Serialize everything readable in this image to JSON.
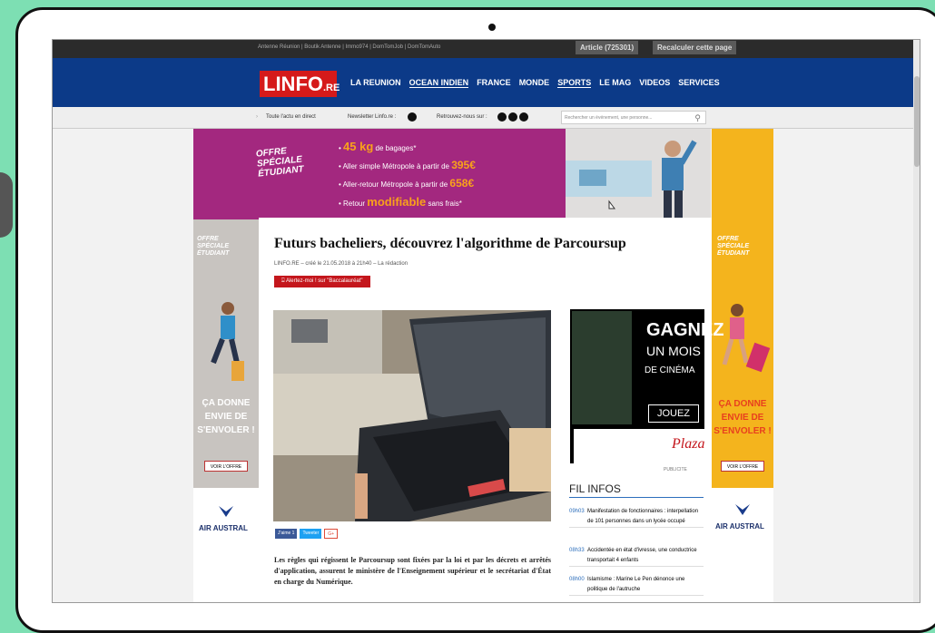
{
  "topbar": {
    "links": "Antenne Réunion | Boutik Antenne | Immo974 | DomTomJob | DomTomAuto",
    "article_pill": "Article (725301)",
    "recalc_pill": "Recalculer cette page"
  },
  "header": {
    "logo_main": "LINFO",
    "logo_suffix": ".RE",
    "nav": [
      "LA REUNION",
      "OCEAN INDIEN",
      "FRANCE",
      "MONDE",
      "SPORTS",
      "LE MAG",
      "VIDEOS",
      "SERVICES"
    ]
  },
  "subbar": {
    "live": "Toute l'actu en direct",
    "newsletter": "Newsletter Linfo.re :",
    "follow": "Retrouvez-nous sur :",
    "search_placeholder": "Rechercher un événement, une personne..."
  },
  "banner": {
    "offre": [
      "OFFRE",
      "SPÉCIALE",
      "ÉTUDIANT"
    ],
    "lines": [
      {
        "big": "45 kg",
        "text": " de bagages*"
      },
      {
        "pre": "Aller simple Métropole à partir de ",
        "big": "395€"
      },
      {
        "pre": "Aller-retour Métropole à partir de ",
        "big": "658€"
      },
      {
        "pre": "Retour ",
        "big": "modifiable",
        "text": " sans frais*"
      }
    ]
  },
  "side_ad": {
    "offre": [
      "OFFRE",
      "SPÉCIALE",
      "ÉTUDIANT"
    ],
    "text": [
      "ÇA DONNE",
      "ENVIE DE",
      "S'ENVOLER !"
    ],
    "button": "VOIR L'OFFRE",
    "brand": "AIR AUSTRAL"
  },
  "article": {
    "title": "Futurs bacheliers, découvrez l'algorithme de Parcoursup",
    "byline": "LINFO.RE – créé le 21.05.2018 à 21h40 – La rédaction",
    "alert": "Alertez-moi ! sur \"Baccalauréat\"",
    "social": [
      "J'aime 1",
      "Tweeter",
      "G+"
    ],
    "body": "Les règles qui régissent le Parcoursup sont fixées par la loi et par les décrets et arrêtés d'application, assurent le ministère de l'Enseignement supérieur et le secrétariat d'État en charge du Numérique."
  },
  "ad": {
    "gagnez": "GAGNEZ",
    "un_mois": "UN MOIS",
    "de_cinema": "DE CINÉMA",
    "jouez": "JOUEZ",
    "plaza": "Plaza",
    "label": "PUBLICITE"
  },
  "fil_infos": {
    "title": "FIL INFOS",
    "items": [
      {
        "time": "09h03",
        "text": "Manifestation de fonctionnaires : interpellation de 101 personnes dans un lycée occupé"
      },
      {
        "time": "08h33",
        "text": "Accidentée en état d'ivresse, une conductrice transportait 4 enfants"
      },
      {
        "time": "08h00",
        "text": "Islamisme : Marine Le Pen dénonce une politique de l'autruche"
      }
    ]
  }
}
